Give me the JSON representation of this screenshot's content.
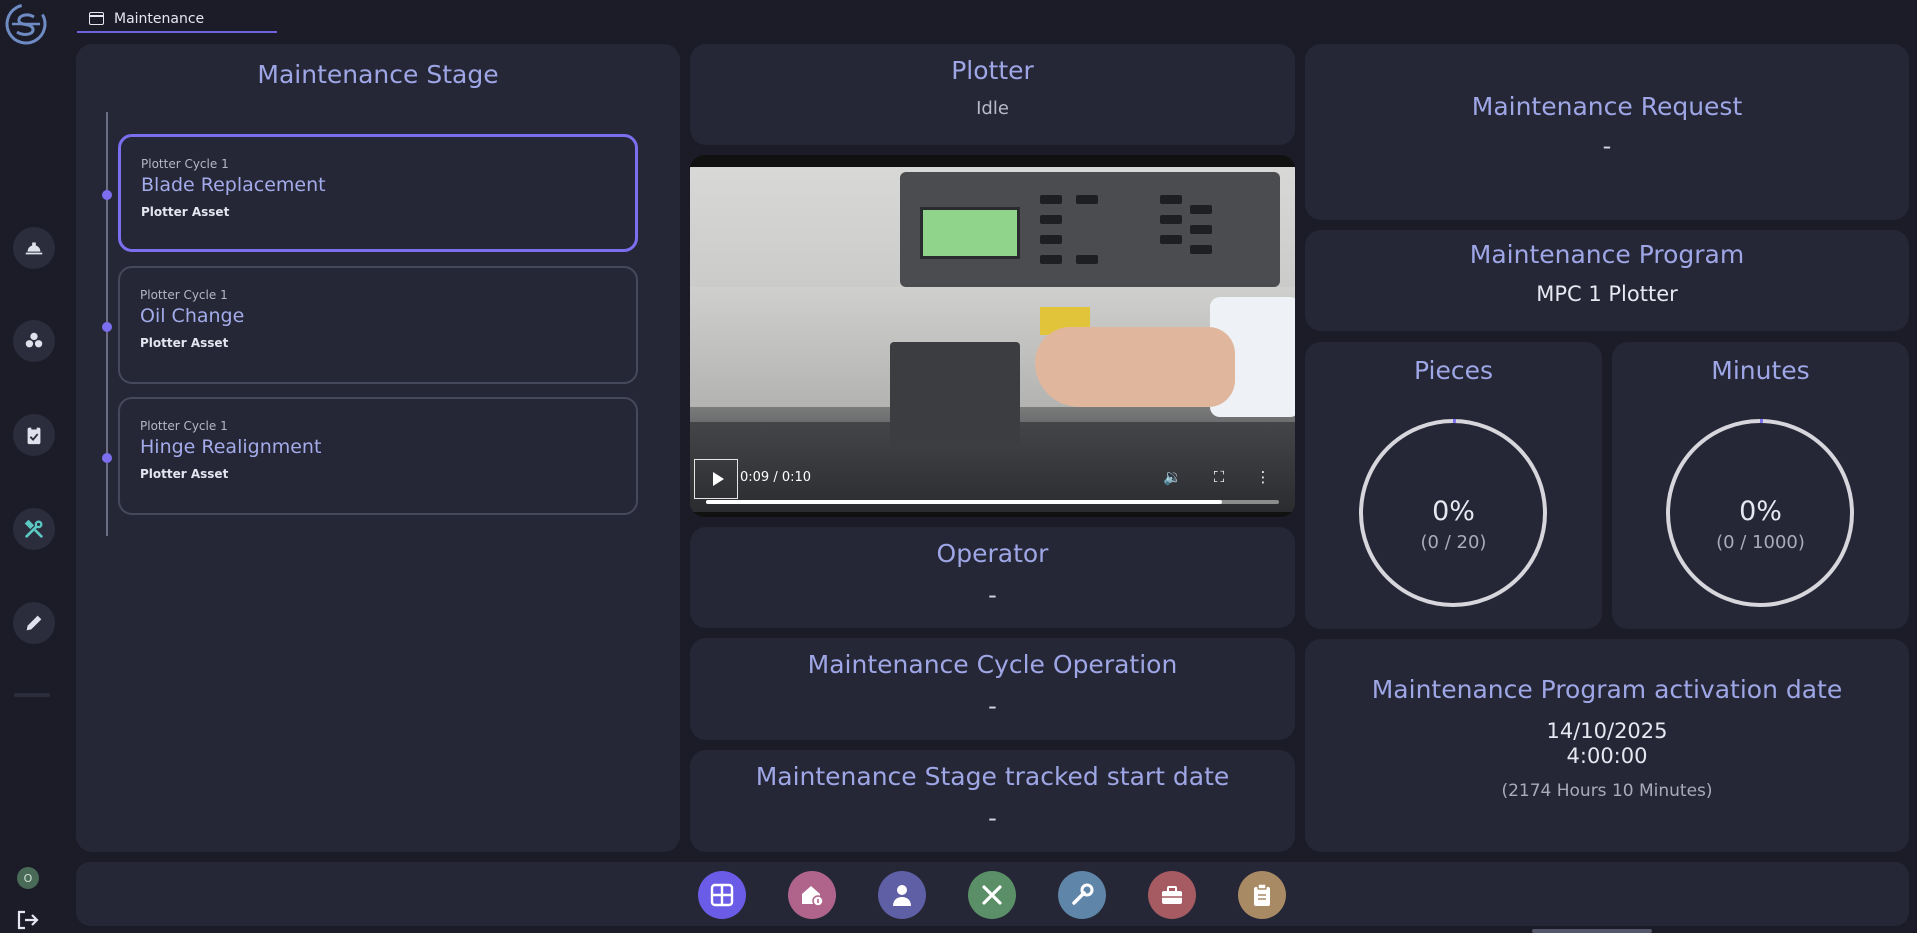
{
  "tab": {
    "label": "Maintenance"
  },
  "sidebar": {
    "items": [
      {
        "icon": "hardhat-icon"
      },
      {
        "icon": "boxes-icon"
      },
      {
        "icon": "clipboard-check-icon"
      },
      {
        "icon": "tools-icon"
      },
      {
        "icon": "pencil-icon"
      }
    ],
    "status_initial": "O"
  },
  "stage": {
    "title": "Maintenance Stage",
    "cards": [
      {
        "cycle": "Plotter Cycle 1",
        "name": "Blade Replacement",
        "asset": "Plotter Asset",
        "active": true
      },
      {
        "cycle": "Plotter Cycle 1",
        "name": "Oil Change",
        "asset": "Plotter Asset",
        "active": false
      },
      {
        "cycle": "Plotter Cycle 1",
        "name": "Hinge Realignment",
        "asset": "Plotter Asset",
        "active": false
      }
    ]
  },
  "plotter": {
    "title": "Plotter",
    "status": "Idle"
  },
  "video": {
    "time": "0:09 / 0:10",
    "progress": 0.9
  },
  "operator": {
    "title": "Operator",
    "value": "-"
  },
  "cycle_operation": {
    "title": "Maintenance Cycle Operation",
    "value": "-"
  },
  "tracked_start": {
    "title": "Maintenance Stage tracked start date",
    "value": "-"
  },
  "request": {
    "title": "Maintenance Request",
    "value": "-"
  },
  "program": {
    "title": "Maintenance Program",
    "value": "MPC 1 Plotter"
  },
  "pieces": {
    "title": "Pieces",
    "percent": "0%",
    "count": "(0 / 20)",
    "fraction": 0
  },
  "minutes": {
    "title": "Minutes",
    "percent": "0%",
    "count": "(0 / 1000)",
    "fraction": 0
  },
  "activation": {
    "title": "Maintenance Program activation date",
    "date": "14/10/2025",
    "time": "4:00:00",
    "duration": "(2174 Hours 10 Minutes)"
  },
  "bottom_bar": {
    "buttons": [
      {
        "icon": "dashboard-grid-icon",
        "color": "#6b5ce7"
      },
      {
        "icon": "home-info-icon",
        "color": "#b0648c"
      },
      {
        "icon": "operator-icon",
        "color": "#5f5fa6"
      },
      {
        "icon": "tools-icon",
        "color": "#5a8f68"
      },
      {
        "icon": "wrench-icon",
        "color": "#5f85a8"
      },
      {
        "icon": "toolbox-icon",
        "color": "#a65a62"
      },
      {
        "icon": "clipboard-icon",
        "color": "#a88a64"
      }
    ]
  },
  "colors": {
    "accent": "#7b6ff0",
    "panel": "#252736",
    "background": "#1b1c28",
    "title": "#9ea6e6"
  }
}
